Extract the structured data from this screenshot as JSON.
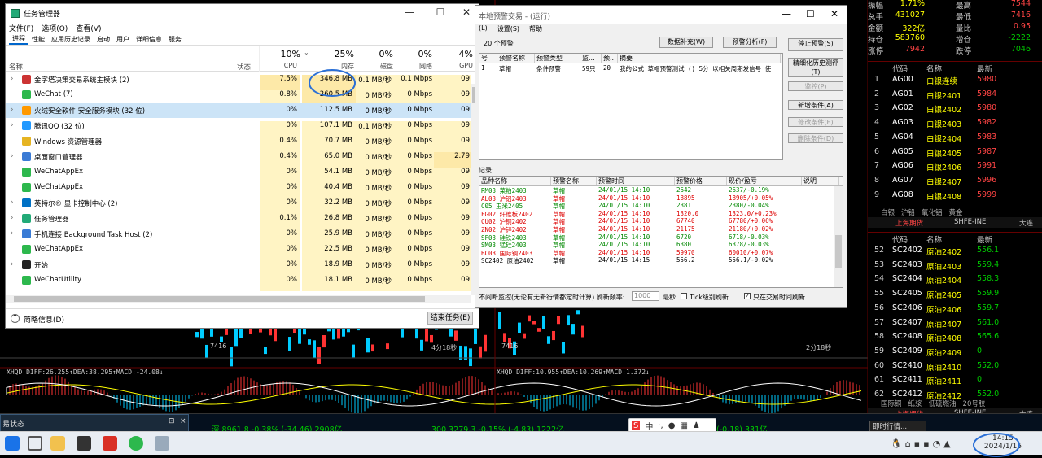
{
  "taskmgr": {
    "title": "任务管理器",
    "menu": [
      "文件(F)",
      "选项(O)",
      "查看(V)"
    ],
    "tabs": [
      "进程",
      "性能",
      "应用历史记录",
      "启动",
      "用户",
      "详细信息",
      "服务"
    ],
    "cols": {
      "name": "名称",
      "status": "状态",
      "cpu_pct": "10%",
      "cpu": "CPU",
      "mem_pct": "25%",
      "mem": "内存",
      "disk_pct": "0%",
      "disk": "磁盘",
      "net_pct": "0%",
      "net": "网络",
      "gpu_pct": "4%",
      "gpu": "GPU"
    },
    "rows": [
      {
        "name": "金字塔决策交易系统主模块 (2)",
        "cpu": "7.5%",
        "mem": "346.8 MB",
        "disk": "0.1 MB/秒",
        "net": "0.1 Mbps",
        "gpu": "09"
      },
      {
        "name": "WeChat (7)",
        "cpu": "0.8%",
        "mem": "260.5 MB",
        "disk": "0 MB/秒",
        "net": "0 Mbps",
        "gpu": "09"
      },
      {
        "name": "火绒安全软件 安全服务模块 (32 位)",
        "cpu": "0%",
        "mem": "112.5 MB",
        "disk": "0 MB/秒",
        "net": "0 Mbps",
        "gpu": "09"
      },
      {
        "name": "腾讯QQ (32 位)",
        "cpu": "0%",
        "mem": "107.1 MB",
        "disk": "0.1 MB/秒",
        "net": "0 Mbps",
        "gpu": "09"
      },
      {
        "name": "Windows 资源管理器",
        "cpu": "0.4%",
        "mem": "70.7 MB",
        "disk": "0 MB/秒",
        "net": "0 Mbps",
        "gpu": "09"
      },
      {
        "name": "桌面窗口管理器",
        "cpu": "0.4%",
        "mem": "65.0 MB",
        "disk": "0 MB/秒",
        "net": "0 Mbps",
        "gpu": "2.79"
      },
      {
        "name": "WeChatAppEx",
        "cpu": "0%",
        "mem": "54.1 MB",
        "disk": "0 MB/秒",
        "net": "0 Mbps",
        "gpu": "09"
      },
      {
        "name": "WeChatAppEx",
        "cpu": "0%",
        "mem": "40.4 MB",
        "disk": "0 MB/秒",
        "net": "0 Mbps",
        "gpu": "09"
      },
      {
        "name": "英特尔® 显卡控制中心 (2)",
        "cpu": "0%",
        "mem": "32.2 MB",
        "disk": "0 MB/秒",
        "net": "0 Mbps",
        "gpu": "09"
      },
      {
        "name": "任务管理器",
        "cpu": "0.1%",
        "mem": "26.8 MB",
        "disk": "0 MB/秒",
        "net": "0 Mbps",
        "gpu": "09"
      },
      {
        "name": "手机连接 Background Task Host (2)",
        "cpu": "0%",
        "mem": "25.9 MB",
        "disk": "0 MB/秒",
        "net": "0 Mbps",
        "gpu": "09"
      },
      {
        "name": "WeChatAppEx",
        "cpu": "0%",
        "mem": "22.5 MB",
        "disk": "0 MB/秒",
        "net": "0 Mbps",
        "gpu": "09"
      },
      {
        "name": "开始",
        "cpu": "0%",
        "mem": "18.9 MB",
        "disk": "0 MB/秒",
        "net": "0 Mbps",
        "gpu": "09"
      },
      {
        "name": "WeChatUtility",
        "cpu": "0%",
        "mem": "18.1 MB",
        "disk": "0 MB/秒",
        "net": "0 Mbps",
        "gpu": "09"
      }
    ],
    "footer_less": "简略信息(D)",
    "end_task": "结束任务(E)"
  },
  "alarm": {
    "title": "本地预警交易 - (运行)",
    "menu": [
      "(L)",
      "设置(S)",
      "帮助"
    ],
    "count": "20 个预警",
    "btn_supplement": "数据补充(W)",
    "btn_analysis": "预警分析(F)",
    "btn_stop": "停止预警(S)",
    "btn_refine": "精细化历史测评(T)",
    "btn_monitor": "监控(P)",
    "btn_add": "新增条件(A)",
    "btn_modify": "修改条件(E)",
    "btn_delete": "删除条件(D)",
    "cond_cols": [
      "号",
      "预警名称",
      "预警类型",
      "监...",
      "预...",
      "摘要"
    ],
    "cond_row": [
      "1",
      "草帽",
      "条件预警",
      "59只",
      "20",
      "我的公式  草帽预警测试 () 5分 以相关周期发信号 使"
    ],
    "record_label": "记录:",
    "rec_cols": [
      "品种名称",
      "预警名称",
      "预警时间",
      "预警价格",
      "现价/盈亏",
      "说明"
    ],
    "records": [
      [
        "RM03 菜粕2403",
        "草帽",
        "24/01/15 14:10",
        "2642",
        "2637/-0.19%"
      ],
      [
        "AL03 沪铝2403",
        "草帽",
        "24/01/15 14:10",
        "18895",
        "18905/+0.05%"
      ],
      [
        "C05 玉米2405",
        "草帽",
        "24/01/15 14:10",
        "2381",
        "2380/-0.04%"
      ],
      [
        "FG02 纤维板2402",
        "草帽",
        "24/01/15 14:10",
        "1320.0",
        "1323.0/+0.23%"
      ],
      [
        "CU02 沪铜2402",
        "草帽",
        "24/01/15 14:10",
        "67740",
        "67780/+0.06%"
      ],
      [
        "ZN02 沪锌2402",
        "草帽",
        "24/01/15 14:10",
        "21175",
        "21180/+0.02%"
      ],
      [
        "SF03 硅铁2403",
        "草帽",
        "24/01/15 14:10",
        "6720",
        "6718/-0.03%"
      ],
      [
        "SM03 锰硅2403",
        "草帽",
        "24/01/15 14:10",
        "6380",
        "6378/-0.03%"
      ],
      [
        "BC03 国际铜2403",
        "草帽",
        "24/01/15 14:10",
        "59970",
        "60010/+0.07%"
      ],
      [
        "SC2402 原油2402",
        "草帽",
        "24/01/15 14:15",
        "556.2",
        "556.1/-0.02%"
      ]
    ],
    "bottom_text": "不间断监控(无论有无新行情都定时计算) 刷新频率:",
    "refresh_val": "1000",
    "ms": "毫秒",
    "tick_label": "Tick级别刷新",
    "trade_only": "只在交易时间刷新"
  },
  "quote": {
    "stats": [
      [
        "振幅",
        "1.71%",
        "最高",
        "7544"
      ],
      [
        "总手",
        "431027",
        "最低",
        "7416"
      ],
      [
        "金额",
        "322亿",
        "量比",
        "0.95"
      ],
      [
        "持仓",
        "583760",
        "增仓",
        "-2222"
      ],
      [
        "涨停",
        "7942",
        "跌停",
        "7046"
      ]
    ],
    "hdr": [
      "代码",
      "名称",
      "最新"
    ],
    "top": [
      [
        "1",
        "AG00",
        "白银连续",
        "5980"
      ],
      [
        "2",
        "AG01",
        "白银2401",
        "5984"
      ],
      [
        "3",
        "AG02",
        "白银2402",
        "5980"
      ],
      [
        "4",
        "AG03",
        "白银2403",
        "5982"
      ],
      [
        "5",
        "AG04",
        "白银2404",
        "5983"
      ],
      [
        "6",
        "AG05",
        "白银2405",
        "5987"
      ],
      [
        "7",
        "AG06",
        "白银2406",
        "5991"
      ],
      [
        "8",
        "AG07",
        "白银2407",
        "5996"
      ],
      [
        "9",
        "AG08",
        "白银2408",
        "5999"
      ]
    ],
    "tabs1": [
      "白银",
      "沪铅",
      "氧化铝",
      "黄金"
    ],
    "ex1": "上海期货",
    "ex2": "SHFE-INE",
    "ex3": "大连",
    "bottom": [
      [
        "52",
        "SC2402",
        "原油2402",
        "556.1"
      ],
      [
        "53",
        "SC2403",
        "原油2403",
        "559.4"
      ],
      [
        "54",
        "SC2404",
        "原油2404",
        "558.3"
      ],
      [
        "55",
        "SC2405",
        "原油2405",
        "559.9"
      ],
      [
        "56",
        "SC2406",
        "原油2406",
        "559.7"
      ],
      [
        "57",
        "SC2407",
        "原油2407",
        "561.0"
      ],
      [
        "58",
        "SC2408",
        "原油2408",
        "565.6"
      ],
      [
        "59",
        "SC2409",
        "原油2409",
        "0"
      ],
      [
        "60",
        "SC2410",
        "原油2410",
        "552.0"
      ],
      [
        "61",
        "SC2411",
        "原油2411",
        "0"
      ],
      [
        "62",
        "SC2412",
        "原油2412",
        "552.0"
      ]
    ],
    "tabs2": [
      "国际铜",
      "纸浆",
      "低硫燃油",
      "20号胶"
    ]
  },
  "indicators": {
    "left": "XHQD DIFF:26.255↑DEA:38.295↑MACD:-24.08↓",
    "mid": "XHQD DIFF:10.955↑DEA:10.269↑MACD:1.372↓",
    "left_time": "4分18秒",
    "mid_time": "2分18秒",
    "price_left": "7416",
    "price_mid": "7416"
  },
  "statusbar": {
    "left_title": "易状态",
    "sz": "深 8961.8 -0.38% (-34.46) 2908亿",
    "hs300": "300 3279.3 -0.15% (-4.83) 1222亿",
    "other": "(-0.18) 331亿",
    "popup": "即时行情..."
  },
  "clock": {
    "time": "14:15",
    "date": "2024/1/15"
  }
}
